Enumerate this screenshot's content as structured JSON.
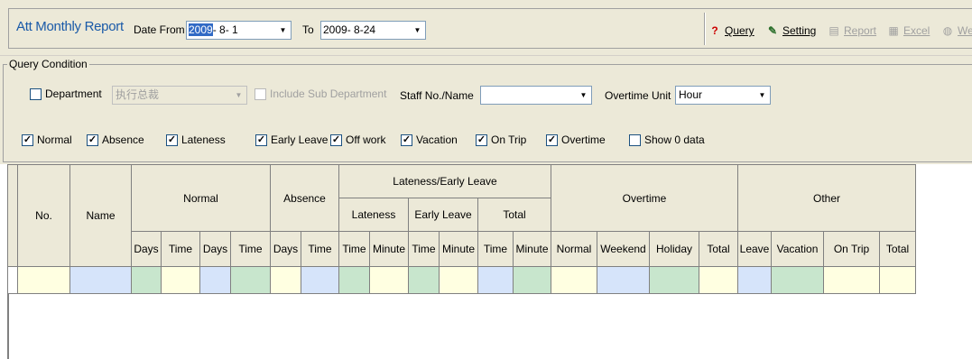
{
  "toolbar": {
    "title": "Att Monthly Report",
    "date_from_label": "Date From",
    "date_from_selected": "2009",
    "date_from_rest": "- 8- 1",
    "to_label": "To",
    "date_to": "2009- 8-24",
    "buttons": {
      "query": "Query",
      "setting": "Setting",
      "report": "Report",
      "excel": "Excel",
      "we": "We"
    }
  },
  "query_condition": {
    "legend": "Query Condition",
    "department_label": "Department",
    "department_value": "执行总裁",
    "include_sub_label": "Include Sub Department",
    "staff_label": "Staff No./Name",
    "staff_value": "",
    "overtime_unit_label": "Overtime Unit",
    "overtime_unit_value": "Hour",
    "filters": [
      {
        "label": "Normal",
        "checked": true
      },
      {
        "label": "Absence",
        "checked": true
      },
      {
        "label": "Lateness",
        "checked": true
      },
      {
        "label": "Early Leave",
        "checked": true
      },
      {
        "label": "Off work",
        "checked": true
      },
      {
        "label": "Vacation",
        "checked": true
      },
      {
        "label": "On Trip",
        "checked": true
      },
      {
        "label": "Overtime",
        "checked": true
      },
      {
        "label": "Show 0 data",
        "checked": false
      }
    ]
  },
  "grid": {
    "header_top": {
      "no": "No.",
      "name": "Name",
      "normal": "Normal",
      "absence": "Absence",
      "lateness_early": "Lateness/Early Leave",
      "overtime": "Overtime",
      "other": "Other"
    },
    "header_mid": {
      "lateness": "Lateness",
      "early_leave": "Early Leave",
      "total": "Total"
    },
    "header_bottom": [
      "Days",
      "Time",
      "Days",
      "Time",
      "Days",
      "Time",
      "Time",
      "Minute",
      "Time",
      "Minute",
      "Time",
      "Minute",
      "Normal",
      "Weekend",
      "Holiday",
      "Total",
      "Leave",
      "Vacation",
      "On Trip",
      "Total"
    ],
    "row_colors": [
      "#ffffe1",
      "#d6e4fa",
      "#c8e6cd",
      "#ffffe1",
      "#d6e4fa",
      "#c8e6cd",
      "#ffffe1",
      "#d6e4fa",
      "#c8e6cd",
      "#ffffe1",
      "#c8e6cd",
      "#ffffe1",
      "#d6e4fa",
      "#c8e6cd",
      "#ffffe1",
      "#d6e4fa",
      "#c8e6cd",
      "#ffffe1",
      "#d6e4fa",
      "#c8e6cd",
      "#ffffe1",
      "#ffffe1"
    ]
  }
}
